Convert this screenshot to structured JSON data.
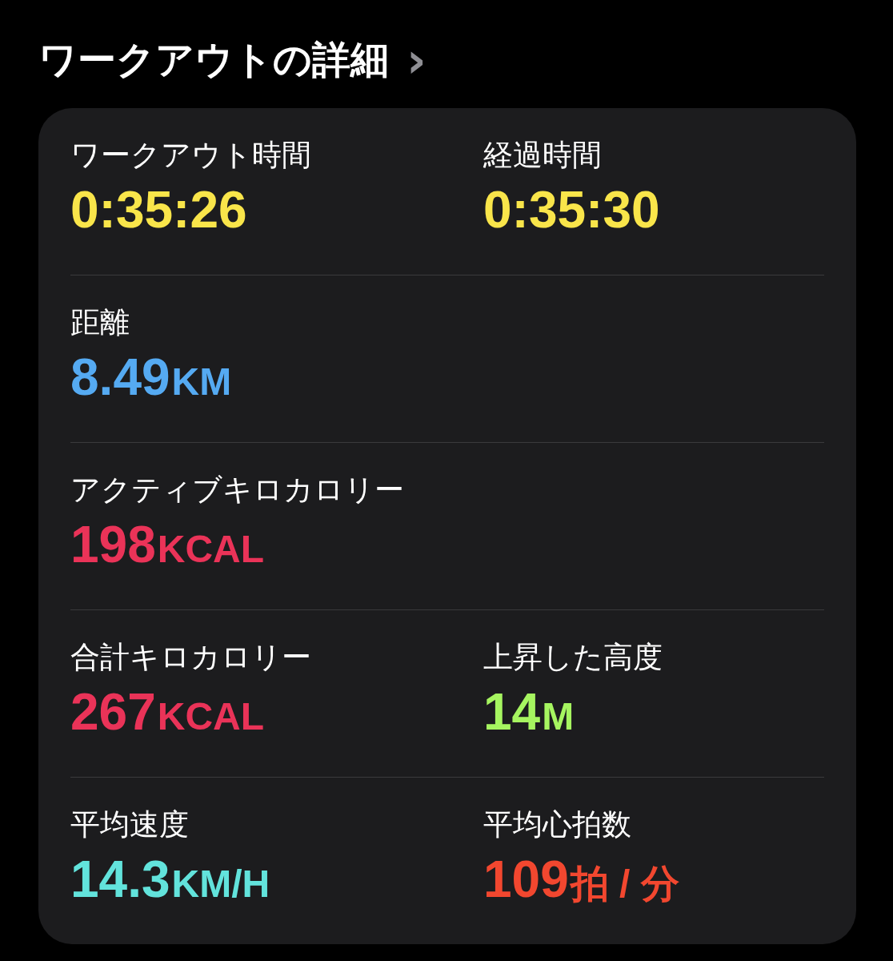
{
  "header": {
    "title": "ワークアウトの詳細",
    "chevron": "›"
  },
  "rows": [
    {
      "cells": [
        {
          "label": "ワークアウト時間",
          "value": "0:35:26",
          "color": "#f9e54a"
        },
        {
          "label": "経過時間",
          "value": "0:35:30",
          "color": "#f9e54a"
        }
      ]
    },
    {
      "cells": [
        {
          "label": "距離",
          "value": "8.49",
          "unit": "KM",
          "color": "#55aaf2"
        }
      ]
    },
    {
      "cells": [
        {
          "label": "アクティブキロカロリー",
          "value": "198",
          "unit": "KCAL",
          "color": "#ea3358"
        }
      ]
    },
    {
      "cells": [
        {
          "label": "合計キロカロリー",
          "value": "267",
          "unit": "KCAL",
          "color": "#ea3358"
        },
        {
          "label": "上昇した高度",
          "value": "14",
          "unit": "M",
          "color": "#a6f560"
        }
      ]
    },
    {
      "cells": [
        {
          "label": "平均速度",
          "value": "14.3",
          "unit": "KM/H",
          "color": "#62e3dc"
        },
        {
          "label": "平均心拍数",
          "value": "109",
          "unit": "拍 / 分",
          "color": "#f2472f"
        }
      ]
    }
  ]
}
